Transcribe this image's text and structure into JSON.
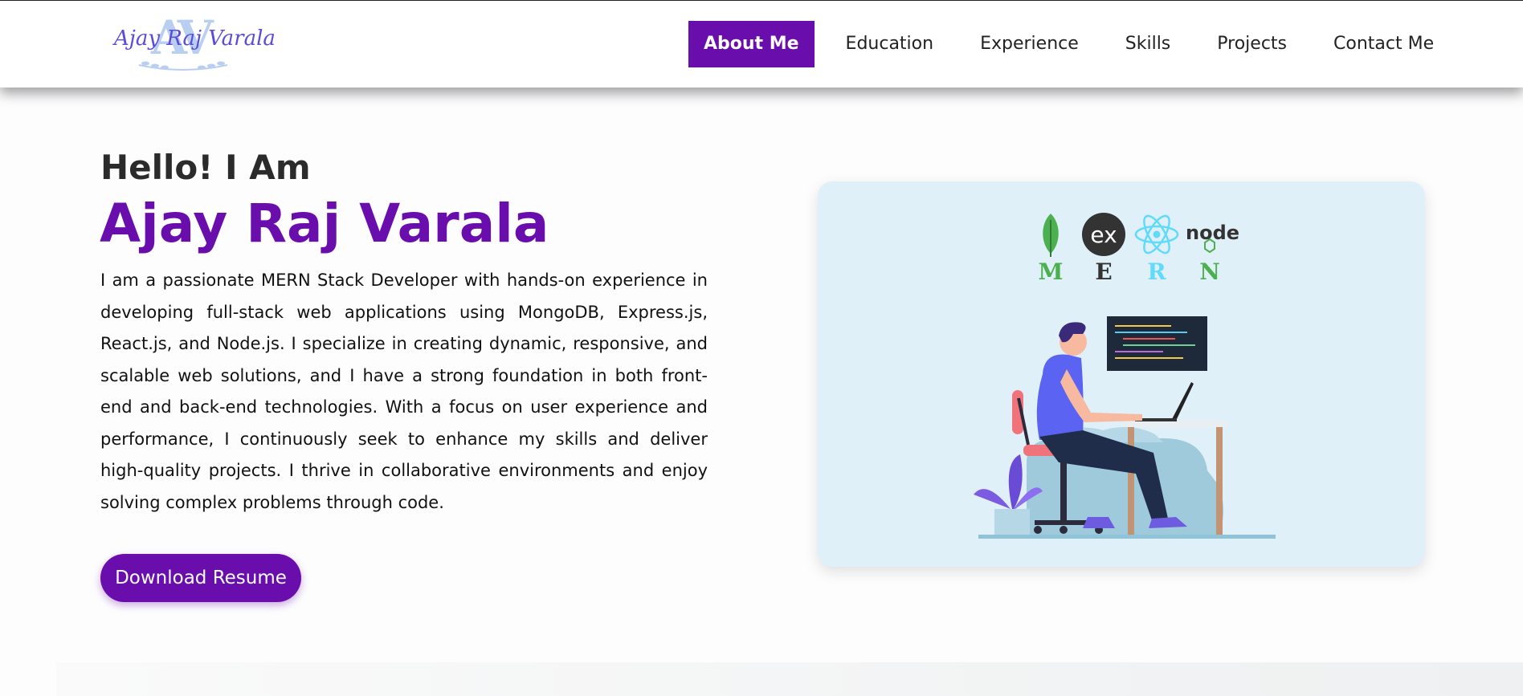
{
  "logo": {
    "monogram": "AV",
    "text": "Ajay Raj Varala"
  },
  "nav": {
    "items": [
      {
        "label": "About Me",
        "active": true
      },
      {
        "label": "Education",
        "active": false
      },
      {
        "label": "Experience",
        "active": false
      },
      {
        "label": "Skills",
        "active": false
      },
      {
        "label": "Projects",
        "active": false
      },
      {
        "label": "Contact Me",
        "active": false
      }
    ]
  },
  "hero": {
    "greeting": "Hello! I Am",
    "name": "Ajay Raj Varala",
    "bio": "I am a passionate MERN Stack Developer with hands-on experience in developing full-stack web applications using MongoDB, Express.js, React.js, and Node.js. I specialize in creating dynamic, responsive, and scalable web solutions, and I have a strong foundation in both front-end and back-end technologies. With a focus on user experience and performance, I continuously seek to enhance my skills and deliver high-quality projects. I thrive in collaborative environments and enjoy solving complex problems through code.",
    "button_label": "Download Resume"
  },
  "tech_stack": {
    "letters": [
      "M",
      "E",
      "R",
      "N"
    ],
    "express_badge": "ex",
    "node_badge": "node",
    "colors": {
      "M": "#4caf50",
      "E": "#333333",
      "R": "#61dafb",
      "N": "#4caf50"
    }
  },
  "colors": {
    "accent": "#6a0dad",
    "card_bg": "#e0f0f8"
  }
}
